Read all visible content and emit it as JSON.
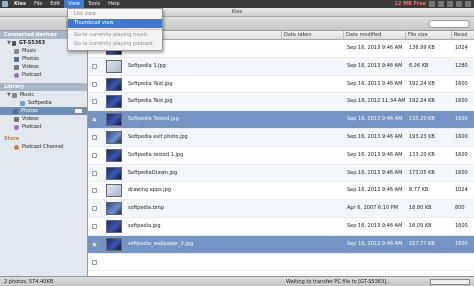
{
  "menubar": {
    "app_name": "Kies",
    "menus": [
      "File",
      "Edit",
      "View",
      "Tools",
      "Help"
    ],
    "active_menu": "View",
    "free_space": "12 MB Free"
  },
  "view_menu": {
    "items": [
      "List view",
      "Thumbnail view",
      "Go to currently playing music",
      "Go to currently playing podcast"
    ],
    "selected": "Thumbnail view"
  },
  "window": {
    "title": "Kies"
  },
  "sidebar": {
    "connected_header": "Connected devices",
    "device": "GT-S5363",
    "device_items": [
      "Music",
      "Photos",
      "Videos",
      "Podcast"
    ],
    "library_header": "Library",
    "library_items": [
      "Music",
      "Softpedia",
      "Photos",
      "Videos",
      "Podcast"
    ],
    "store_header": "Store",
    "store_items": [
      "Podcast Channel"
    ]
  },
  "table": {
    "columns": [
      "Date taken",
      "Date modified",
      "File size",
      "Resol"
    ],
    "rows": [
      {
        "name": "Softpedia",
        "date_modified": "Sep 16, 2013 9:46 AM",
        "size": "136.99 KB",
        "res": "1024",
        "checked": false,
        "thumb": "dark"
      },
      {
        "name": "Softpedia 1.jpg",
        "date_modified": "Sep 16, 2013 9:46 AM",
        "size": "6.26 KB",
        "res": "1280",
        "checked": false,
        "thumb": "light"
      },
      {
        "name": "Softpedia Test.jpg",
        "date_modified": "Sep 16, 2013 9:46 AM",
        "size": "192.24 KB",
        "res": "1600",
        "checked": false,
        "thumb": "dark"
      },
      {
        "name": "Softpedia Test.jpg",
        "date_modified": "Sep 18, 2012 11:34 AM",
        "size": "192.24 KB",
        "res": "1600",
        "checked": false,
        "thumb": "dark"
      },
      {
        "name": "Softpedia Tested.jpg",
        "date_modified": "Sep 16, 2013 9:46 AM",
        "size": "133.20 KB",
        "res": "1600",
        "checked": true,
        "thumb": "dark",
        "selected": true
      },
      {
        "name": "Softpedia exif photo.jpg",
        "date_modified": "Sep 16, 2013 9:46 AM",
        "size": "193.23 KB",
        "res": "1600",
        "checked": false,
        "thumb": "mid"
      },
      {
        "name": "Softpedia tested 1.jpg",
        "date_modified": "Sep 16, 2013 9:46 AM",
        "size": "133.20 KB",
        "res": "1600",
        "checked": false,
        "thumb": "dark"
      },
      {
        "name": "SoftpediaDrawn.jpg",
        "date_modified": "Sep 16, 2013 9:46 AM",
        "size": "173.05 KB",
        "res": "1600",
        "checked": false,
        "thumb": "dark"
      },
      {
        "name": "drawing apps.jpg",
        "date_modified": "Sep 16, 2013 9:46 AM",
        "size": "8.77 KB",
        "res": "1024",
        "checked": false,
        "thumb": "light"
      },
      {
        "name": "softpedia.bmp",
        "date_modified": "Apr 6, 2007 6:10 PM",
        "size": "18.80 KB",
        "res": "800",
        "checked": false,
        "thumb": "mid"
      },
      {
        "name": "softpedia.jpg",
        "date_modified": "Sep 16, 2013 9:46 AM",
        "size": "18.09 KB",
        "res": "1600",
        "checked": false,
        "thumb": "dark"
      },
      {
        "name": "softpedia_wallpaper_2.jpg",
        "date_modified": "Sep 16, 2013 9:46 AM",
        "size": "157.77 KB",
        "res": "1600",
        "checked": true,
        "thumb": "dark",
        "selected": true
      },
      {
        "name": "",
        "date_modified": "",
        "size": "",
        "res": "",
        "checked": false,
        "thumb": "none"
      }
    ]
  },
  "status": {
    "left": "2 photos, 574.40KB",
    "middle": "Waiting to transfer PC file to [GT-S5363]..."
  }
}
